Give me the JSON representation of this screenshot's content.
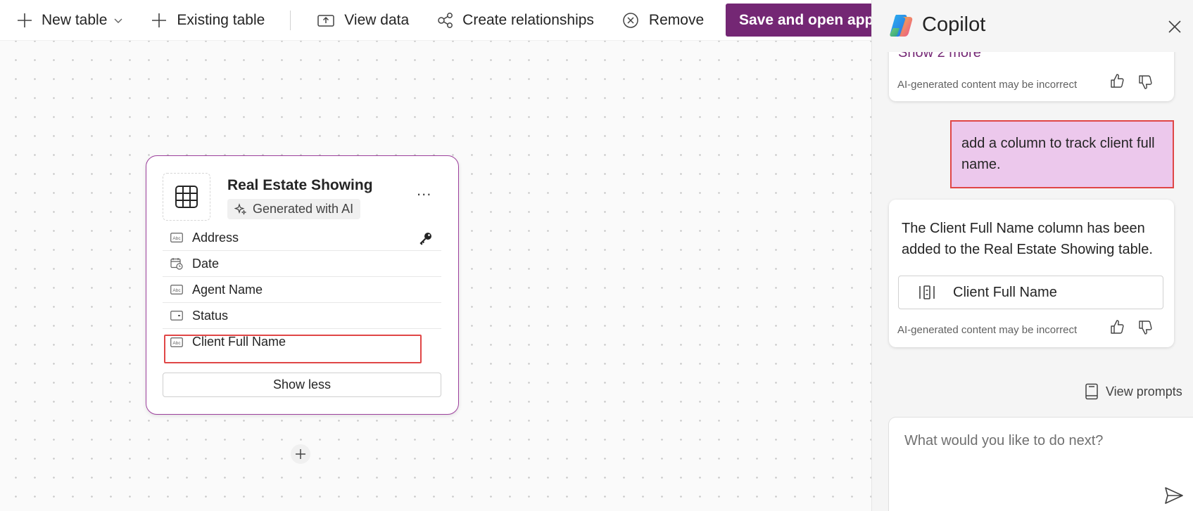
{
  "toolbar": {
    "new_table": "New table",
    "existing_table": "Existing table",
    "view_data": "View data",
    "create_relationships": "Create relationships",
    "remove": "Remove",
    "save_open": "Save and open app"
  },
  "table_card": {
    "title": "Real Estate Showing",
    "badge": "Generated with AI",
    "columns": [
      {
        "label": "Address",
        "icon": "text-column-icon"
      },
      {
        "label": "Date",
        "icon": "date-column-icon"
      },
      {
        "label": "Agent Name",
        "icon": "text-column-icon"
      },
      {
        "label": "Status",
        "icon": "choice-column-icon"
      },
      {
        "label": "Client Full Name",
        "icon": "text-column-icon"
      }
    ],
    "show_less": "Show less"
  },
  "copilot": {
    "title": "Copilot",
    "prev_card": {
      "show_more": "Show 2 more",
      "disclaimer": "AI-generated content may be incorrect"
    },
    "user_message": "add a column to track client full name.",
    "response": {
      "text": "The Client Full Name column has been added to the Real Estate Showing table.",
      "chip": "Client Full Name",
      "disclaimer": "AI-generated content may be incorrect"
    },
    "view_prompts": "View prompts",
    "input_placeholder": "What would you like to do next?"
  },
  "colors": {
    "accent": "#742774",
    "highlight_border": "#e04646",
    "user_bubble": "#ecc8ec"
  }
}
